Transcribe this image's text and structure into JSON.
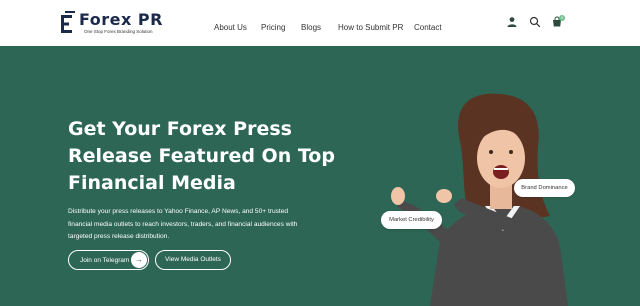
{
  "header": {
    "logo_text": "Forex PR",
    "logo_tagline": "One Stop Forex Branding Solution",
    "nav": [
      {
        "label": "About Us"
      },
      {
        "label": "Pricing"
      },
      {
        "label": "Blogs"
      },
      {
        "label": "How to Submit PR"
      },
      {
        "label": "Contact"
      }
    ],
    "icons": [
      "user-icon",
      "search-icon",
      "cart-icon"
    ],
    "cart_count": "0"
  },
  "hero": {
    "headline": "Get Your Forex Press Release Featured On Top Financial Media",
    "subtext": "Distribute your press releases to Yahoo Finance, AP News, and 50+ trusted financial media outlets to reach investors, traders, and financial audiences with targeted press release distribution.",
    "btn_telegram": "Join on Telegram",
    "btn_outlets": "View Media Outlets",
    "pill_brand": "Brand Dominance",
    "pill_market": "Market Credibility"
  },
  "colors": {
    "hero_bg": "#2d6655",
    "logo": "#1c2a4a",
    "text_dark": "#333333"
  }
}
